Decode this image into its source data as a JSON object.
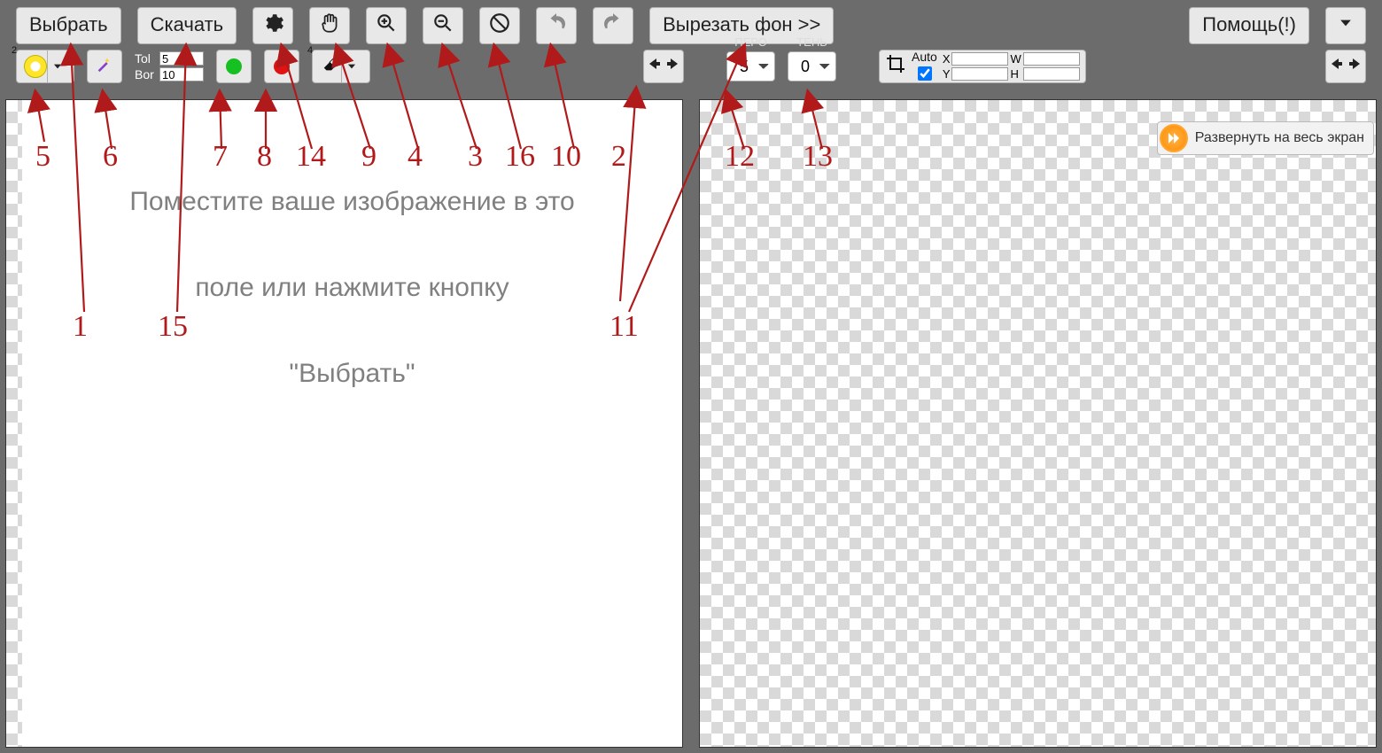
{
  "toolbar": {
    "choose": "Выбрать",
    "download": "Скачать",
    "cut_bg": "Вырезать фон >>",
    "help": "Помощь(!)"
  },
  "row2": {
    "tol_label": "Tol",
    "bor_label": "Bor",
    "tol_value": "5",
    "bor_value": "10",
    "badge1": "2",
    "badge2": "4",
    "pen_header": "ПЕРО",
    "shadow_header": "ТЕНЬ",
    "pen_value": "5",
    "shadow_value": "0",
    "auto_label": "Auto",
    "x_label": "X",
    "y_label": "Y",
    "w_label": "W",
    "h_label": "H",
    "x_val": "",
    "y_val": "",
    "w_val": "",
    "h_val": ""
  },
  "left_placeholder": {
    "line1": "Поместите ваше изображение в это",
    "line2": "поле или нажмите кнопку",
    "line3": "\"Выбрать\""
  },
  "right_expand": "Развернуть на весь экран",
  "annotations": {
    "n1": "1",
    "n2": "2",
    "n3": "3",
    "n4": "4",
    "n5": "5",
    "n6": "6",
    "n7": "7",
    "n8": "8",
    "n9": "9",
    "n10": "10",
    "n11": "11",
    "n12": "12",
    "n13": "13",
    "n14": "14",
    "n15": "15",
    "n16": "16"
  }
}
